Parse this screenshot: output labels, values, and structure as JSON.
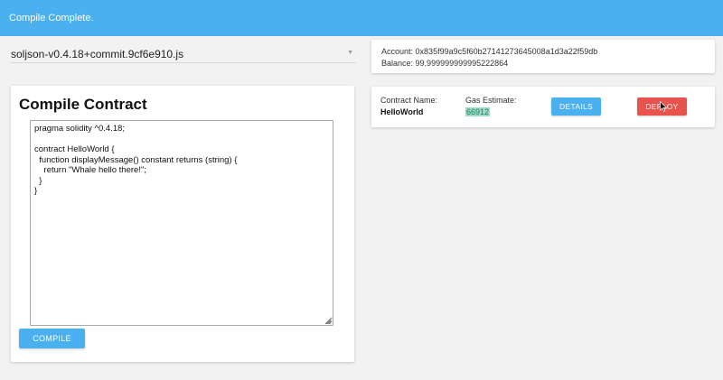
{
  "banner": {
    "message": "Compile Complete."
  },
  "compiler": {
    "selected_version": "soljson-v0.4.18+commit.9cf6e910.js",
    "dropdown_icon": "caret-down-icon"
  },
  "compile_panel": {
    "title": "Compile Contract",
    "source_code": "pragma solidity ^0.4.18;\n\ncontract HelloWorld {\n  function displayMessage() constant returns (string) {\n    return \"Whale hello there!\";\n  }\n}",
    "compile_label": "COMPILE"
  },
  "account": {
    "address_label": "Account:",
    "address": "0x835f99a9c5f60b27141273645008a1d3a22f59db",
    "balance_label": "Balance:",
    "balance": "99.999999999995222864"
  },
  "contract": {
    "name_label": "Contract Name:",
    "name": "HelloWorld",
    "gas_label": "Gas Estimate:",
    "gas_value": "66912",
    "details_label": "DETAILS",
    "deploy_label": "DEPLOY"
  },
  "colors": {
    "accent": "#4ab0f0",
    "danger": "#e9534d",
    "highlight": "#9fdcc3"
  }
}
